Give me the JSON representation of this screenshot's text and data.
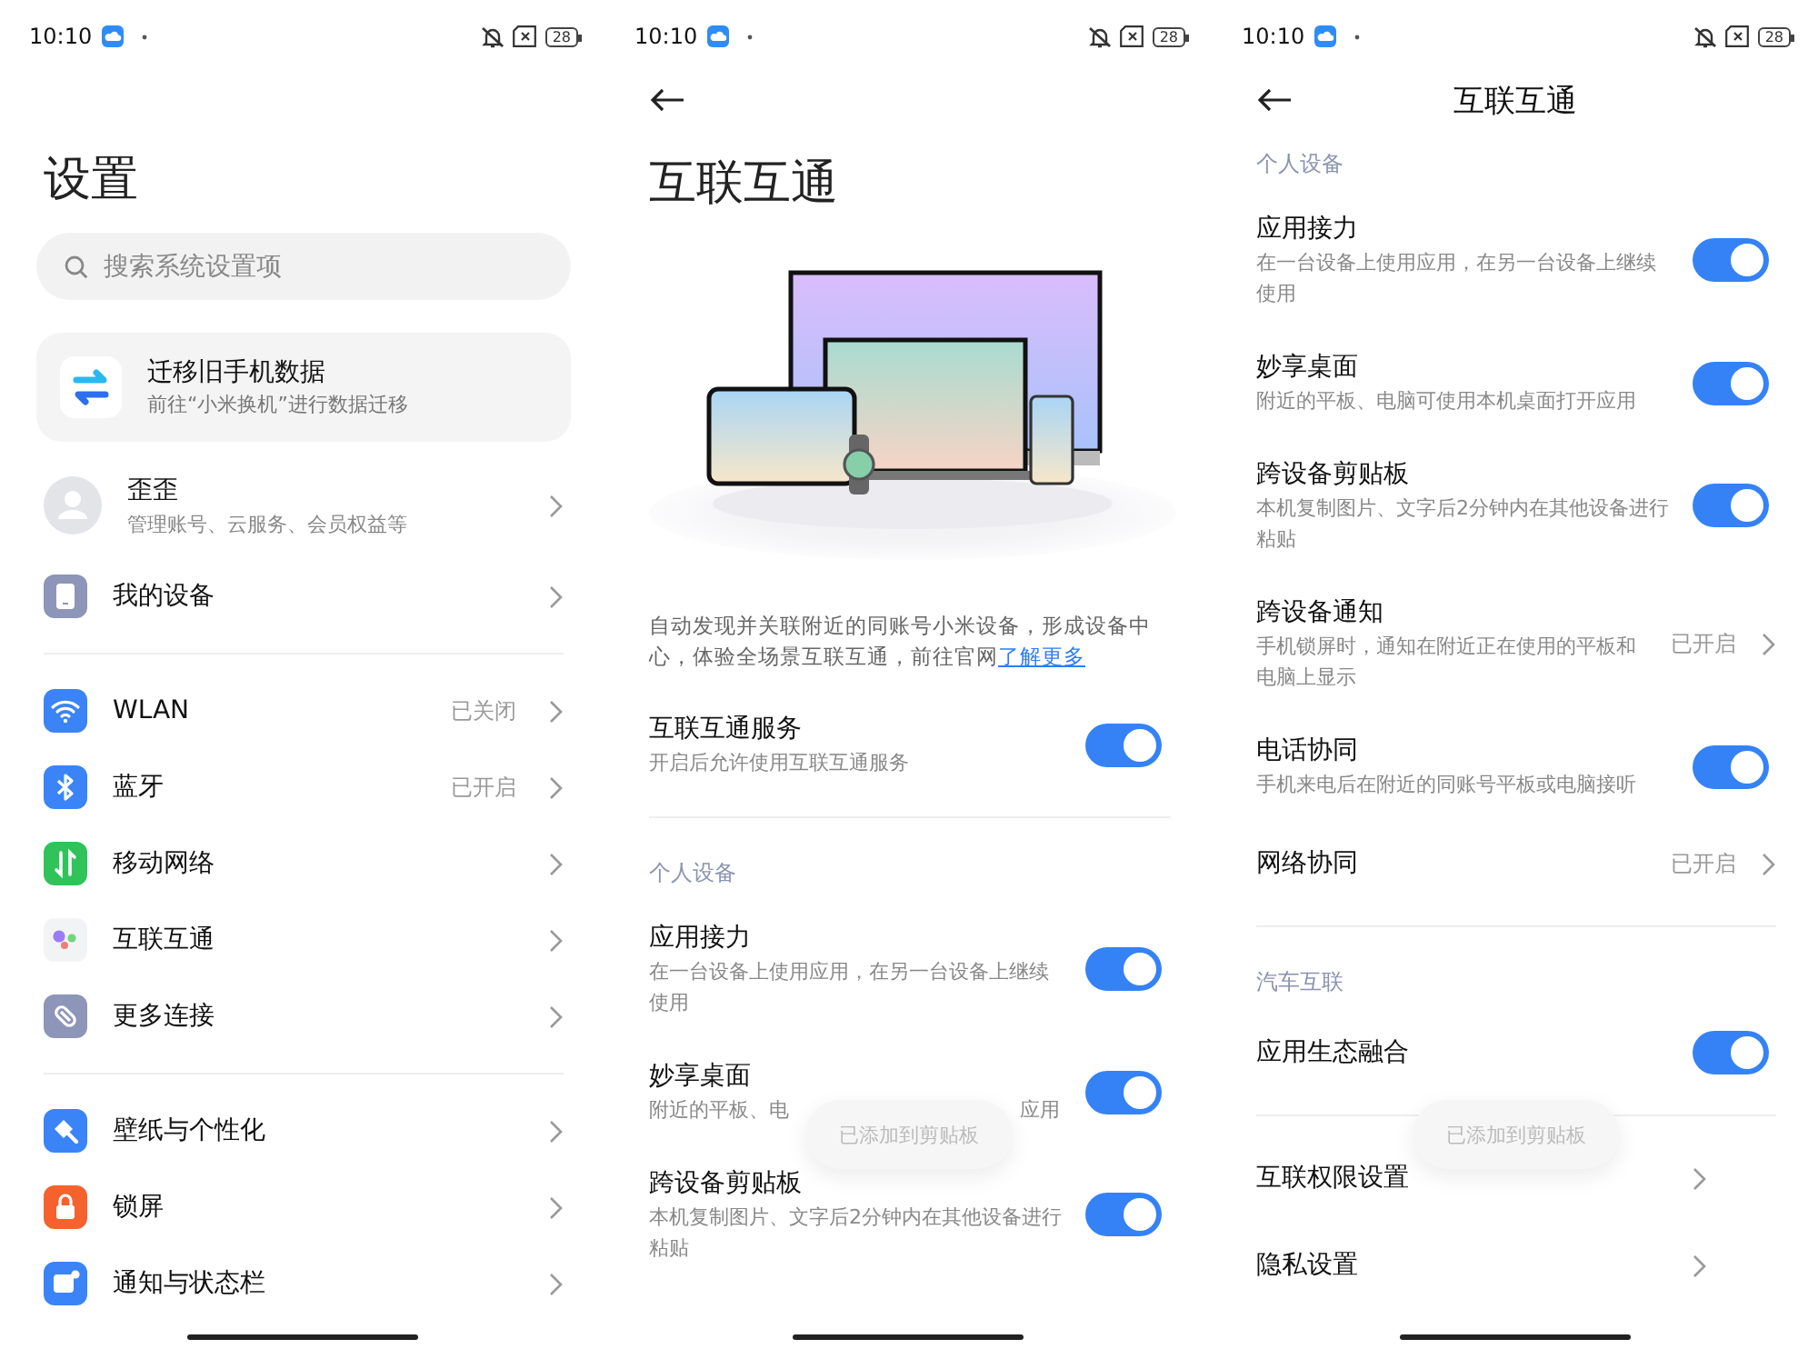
{
  "screens": [
    {
      "kind": "home",
      "status_bar": {
        "time": "10:10",
        "battery": "28"
      },
      "title": "设置",
      "search": {
        "placeholder": "搜索系统设置项"
      },
      "migrate_card": {
        "title": "迁移旧手机数据",
        "subtitle": "前往“小米换机”进行数据迁移"
      },
      "account": {
        "name": "歪歪",
        "subtitle": "管理账号、云服务、会员权益等"
      },
      "groups": [
        {
          "items": [
            {
              "kind": "device",
              "label": "我的设备"
            }
          ]
        },
        {
          "items": [
            {
              "kind": "wifi",
              "label": "WLAN",
              "value": "已关闭"
            },
            {
              "kind": "bluetooth",
              "label": "蓝牙",
              "value": "已开启"
            },
            {
              "kind": "mobile",
              "label": "移动网络"
            },
            {
              "kind": "connect",
              "label": "互联互通"
            },
            {
              "kind": "link",
              "label": "更多连接"
            }
          ]
        },
        {
          "items": [
            {
              "kind": "wallpaper",
              "label": "壁纸与个性化"
            },
            {
              "kind": "lock",
              "label": "锁屏"
            },
            {
              "kind": "notification",
              "label": "通知与状态栏"
            }
          ]
        }
      ]
    },
    {
      "kind": "intro",
      "status_bar": {
        "time": "10:10",
        "battery": "28"
      },
      "title": "互联互通",
      "intro": {
        "text": "自动发现并关联附近的同账号小米设备，形成设备中心，体验全场景互联互通，前往官网",
        "link": "了解更多"
      },
      "items": [
        {
          "kind": "toggle",
          "title": "互联互通服务",
          "description": "开启后允许使用互联互通服务",
          "on": true
        },
        {
          "kind": "divider"
        },
        {
          "kind": "section",
          "label": "个人设备"
        },
        {
          "kind": "toggle",
          "title": "应用接力",
          "description": "在一台设备上使用应用，在另一台设备上继续使用",
          "on": true
        },
        {
          "kind": "toggle",
          "title": "妙享桌面",
          "description_segments": [
            "附近的平板、电",
            "应用"
          ],
          "on": true
        },
        {
          "kind": "toggle",
          "title": "跨设备剪贴板",
          "description": "本机复制图片、文字后2分钟内在其他设备进行粘贴",
          "on": true
        }
      ],
      "toast": "已添加到剪贴板"
    },
    {
      "kind": "detail",
      "status_bar": {
        "time": "10:10",
        "battery": "28"
      },
      "title": "互联互通",
      "items": [
        {
          "kind": "section",
          "label": "个人设备"
        },
        {
          "kind": "toggle",
          "title": "应用接力",
          "description": "在一台设备上使用应用，在另一台设备上继续使用",
          "on": true
        },
        {
          "kind": "toggle",
          "title": "妙享桌面",
          "description": "附近的平板、电脑可使用本机桌面打开应用",
          "on": true
        },
        {
          "kind": "toggle",
          "title": "跨设备剪贴板",
          "description": "本机复制图片、文字后2分钟内在其他设备进行粘贴",
          "on": true
        },
        {
          "kind": "nav",
          "title": "跨设备通知",
          "description": "手机锁屏时，通知在附近正在使用的平板和电脑上显示",
          "value": "已开启"
        },
        {
          "kind": "toggle",
          "title": "电话协同",
          "description": "手机来电后在附近的同账号平板或电脑接听",
          "on": true
        },
        {
          "kind": "nav",
          "title": "网络协同",
          "value": "已开启"
        },
        {
          "kind": "divider"
        },
        {
          "kind": "section",
          "label": "汽车互联"
        },
        {
          "kind": "toggle",
          "title": "应用生态融合",
          "on": true
        },
        {
          "kind": "divider"
        },
        {
          "kind": "nav",
          "title": "互联权限设置"
        },
        {
          "kind": "nav",
          "title": "隐私设置"
        }
      ],
      "toast": "已添加到剪贴板"
    }
  ]
}
